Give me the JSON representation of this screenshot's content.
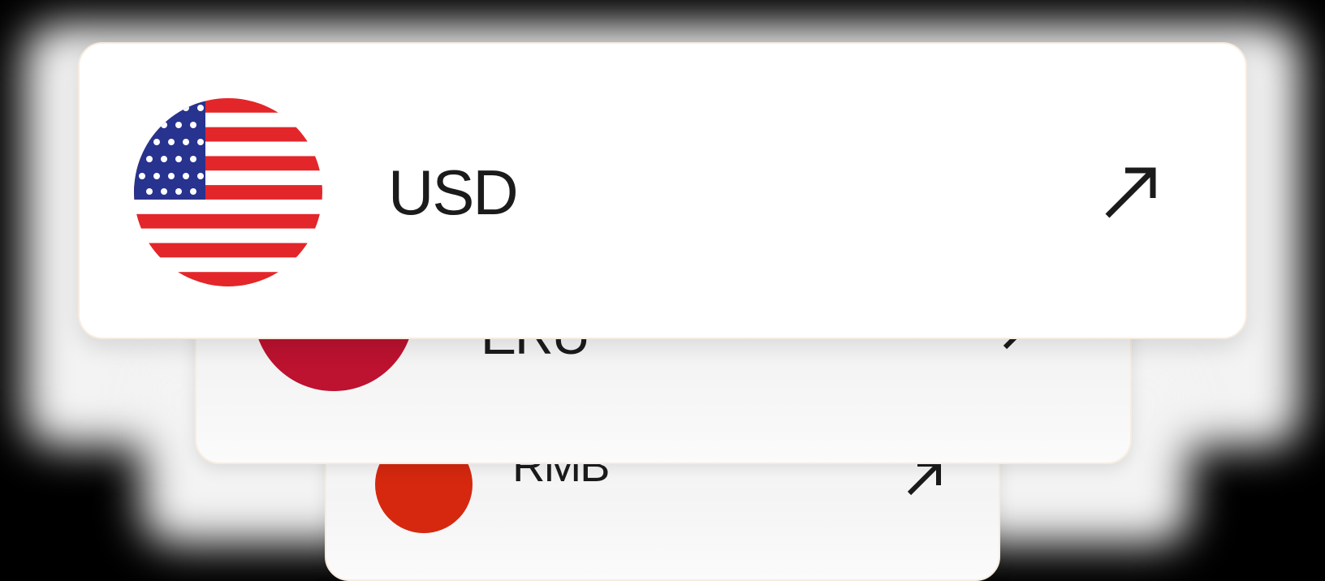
{
  "currencies": [
    {
      "code": "USD",
      "flag_icon": "us-flag-icon",
      "action_icon": "arrow-up-right-icon"
    },
    {
      "code": "ERU",
      "flag_icon": "flag-icon",
      "action_icon": "arrow-up-right-icon"
    },
    {
      "code": "RMB",
      "flag_icon": "cn-flag-icon",
      "action_icon": "arrow-up-right-icon"
    }
  ],
  "colors": {
    "card_border": "#f7ecdf",
    "text": "#1b1b1b",
    "us_red": "#e3262a",
    "us_blue": "#27338e",
    "crimson": "#bd1230",
    "cn_red": "#d6280f",
    "cn_star": "#f5d311"
  }
}
